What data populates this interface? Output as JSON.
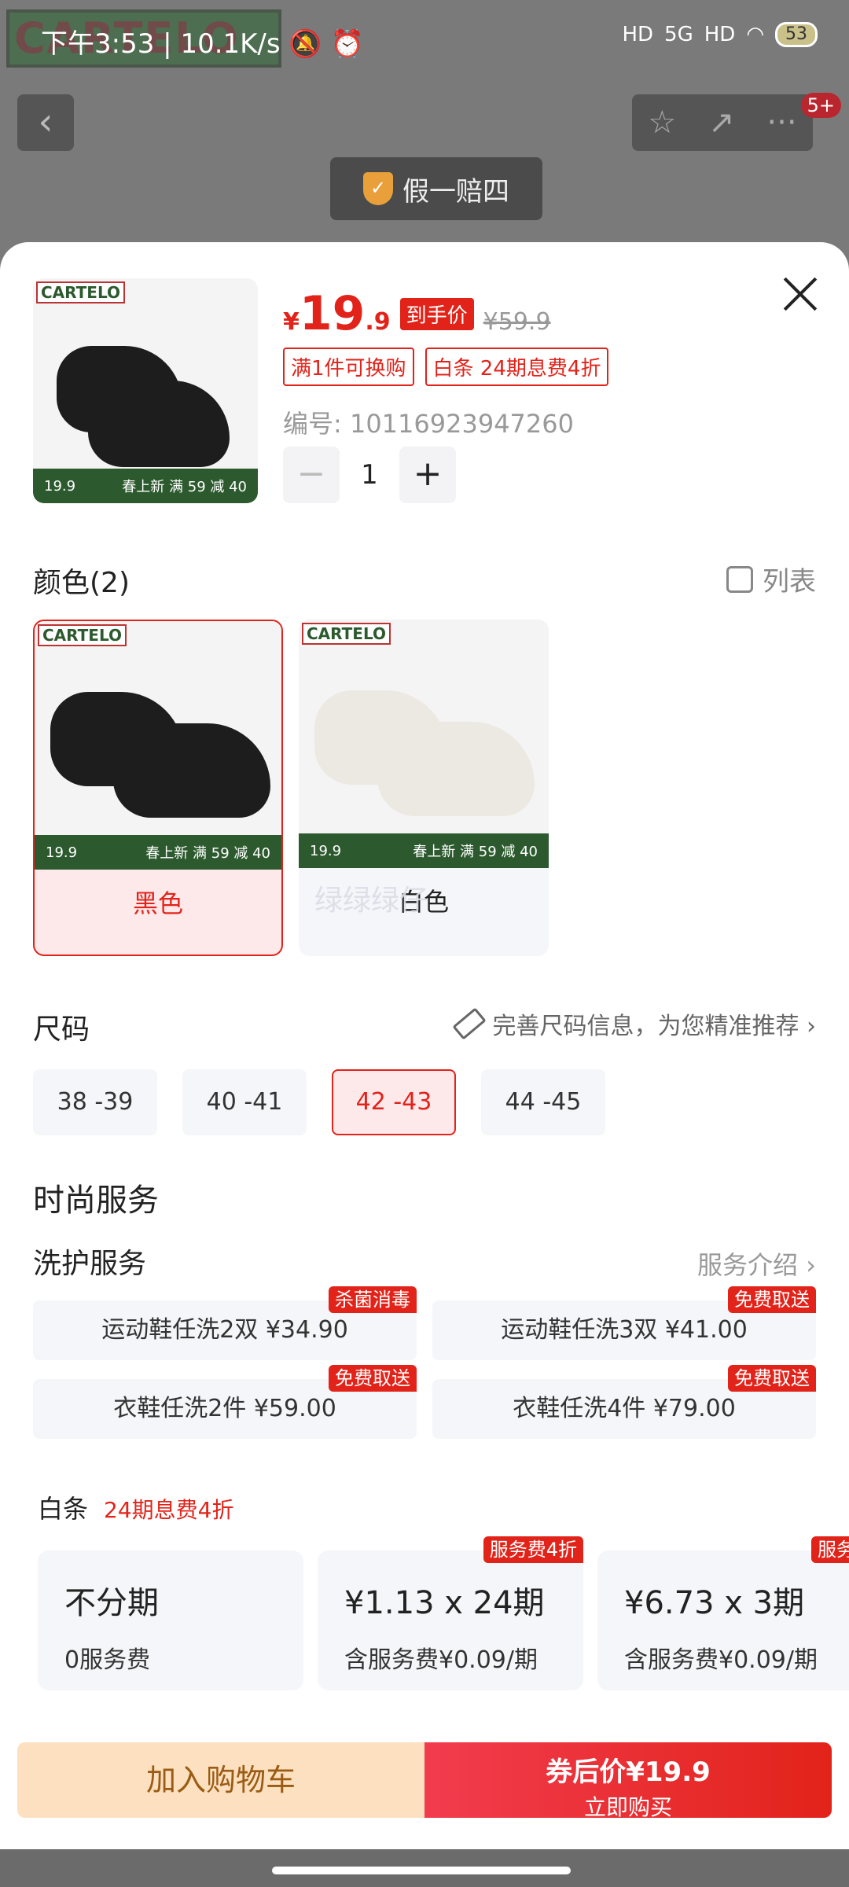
{
  "status": {
    "time": "下午3:53",
    "speed": "10.1K/s",
    "battery": "53",
    "network": "5G"
  },
  "bg": {
    "brand": "CARTELO",
    "guarantee": "假一赔四",
    "badge": "5+"
  },
  "product": {
    "price_yen": "¥",
    "price_int": "19",
    "price_dec": ".9",
    "price_tag": "到手价",
    "orig_price": "¥59.9",
    "tags": [
      "满1件可换购",
      "白条 24期息费4折"
    ],
    "sku": "编号: 10116923947260",
    "qty": "1",
    "thumb_brand": "CARTELO",
    "thumb_promo_price": "19.9",
    "thumb_promo_text": "春上新 满 59 减 40"
  },
  "color": {
    "title": "颜色(2)",
    "list_label": "列表",
    "options": [
      {
        "label": "黑色"
      },
      {
        "label": "白色"
      }
    ],
    "watermark": "绿绿绿仔"
  },
  "size": {
    "title": "尺码",
    "hint": "完善尺码信息，为您精准推荐 ›",
    "options": [
      "38 -39",
      "40 -41",
      "42 -43",
      "44 -45"
    ]
  },
  "services": {
    "title": "时尚服务",
    "sub": "洗护服务",
    "intro": "服务介绍 ›",
    "items": [
      {
        "label": "运动鞋任洗2双  ¥34.90",
        "badge": "杀菌消毒"
      },
      {
        "label": "运动鞋任洗3双  ¥41.00",
        "badge": "免费取送"
      },
      {
        "label": "衣鞋任洗2件  ¥59.00",
        "badge": "免费取送"
      },
      {
        "label": "衣鞋任洗4件  ¥79.00",
        "badge": "免费取送"
      }
    ]
  },
  "baitiao": {
    "title": "白条",
    "rate": "24期息费4折",
    "plans": [
      {
        "main": "不分期",
        "sub": "0服务费",
        "badge": ""
      },
      {
        "main": "¥1.13 x 24期",
        "sub": "含服务费¥0.09/期",
        "badge": "服务费4折"
      },
      {
        "main": "¥6.73 x 3期",
        "sub": "含服务费¥0.09/期",
        "badge": "服务费"
      }
    ]
  },
  "bottom": {
    "add_cart": "加入购物车",
    "coupon_price": "券后价¥19.9",
    "buy_now": "立即购买"
  }
}
